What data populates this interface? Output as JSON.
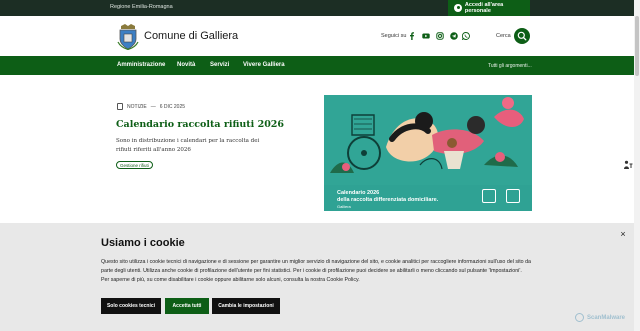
{
  "topbar": {
    "region": "Regione Emilia-Romagna",
    "login_label": "Accedi all'area personale",
    "login_icon": "user-icon"
  },
  "header": {
    "title": "Comune di Galliera",
    "social_label": "Seguici su",
    "social_icons": [
      "facebook-icon",
      "youtube-icon",
      "instagram-icon",
      "telegram-icon",
      "whatsapp-icon"
    ],
    "search_label": "Cerca",
    "search_icon": "search-icon"
  },
  "nav": {
    "items": [
      "Amministrazione",
      "Novità",
      "Servizi",
      "Vivere Galliera"
    ],
    "all_topics": "Tutti gli argomenti..."
  },
  "article": {
    "category": "NOTIZIE",
    "separator": "—",
    "date": "6 DIC 2025",
    "title": "Calendario raccolta rifiuti 2026",
    "excerpt": "Sono in distribuzione i calendari per la raccolta dei rifiuti riferiti all'anno 2026",
    "tag": "Gestione rifiuti"
  },
  "hero": {
    "line1": "Calendario 2026",
    "line2": "della raccolta differenziata domiciliare.",
    "line3": "Galliera"
  },
  "cookie": {
    "title": "Usiamo i cookie",
    "text": "Questo sito utilizza i cookie tecnici di navigazione e di sessione per garantire un miglior servizio di navigazione del sito, e cookie analitici per raccogliere informazioni sull'uso del sito da parte degli utenti. Utilizza anche cookie di profilazione dell'utente per fini statistici. Per i cookie di profilazione puoi decidere se abilitarli o meno cliccando sul pulsante 'Impostazioni'. Per saperne di più, su come disabilitare i cookie oppure abilitarne solo alcuni, consulta la nostra Cookie Policy.",
    "buttons": [
      "Solo cookies tecnici",
      "Accetta tutti",
      "Cambia le impostazioni"
    ],
    "close": "×"
  },
  "watermark": "ScanMalware",
  "colors": {
    "brand_green": "#0d5e16",
    "topbar": "#1c2e24",
    "cookie_bg": "#e8e8e8",
    "dark_button": "#111111"
  }
}
